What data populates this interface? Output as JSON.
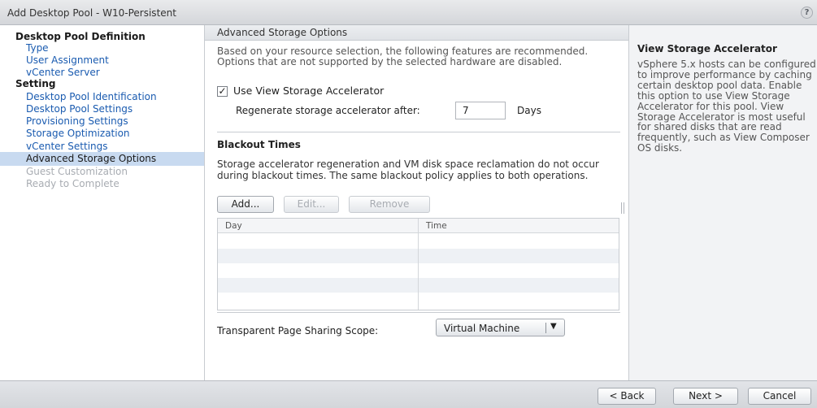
{
  "window": {
    "title": "Add Desktop Pool - W10-Persistent",
    "help_icon": "?"
  },
  "nav": {
    "section1_heading": "Desktop Pool Definition",
    "section1_items": [
      {
        "label": "Type",
        "state": "link"
      },
      {
        "label": "User Assignment",
        "state": "link"
      },
      {
        "label": "vCenter Server",
        "state": "link"
      }
    ],
    "section2_heading": "Setting",
    "section2_items": [
      {
        "label": "Desktop Pool Identification",
        "state": "link"
      },
      {
        "label": "Desktop Pool Settings",
        "state": "link"
      },
      {
        "label": "Provisioning Settings",
        "state": "link"
      },
      {
        "label": "Storage Optimization",
        "state": "link"
      },
      {
        "label": "vCenter Settings",
        "state": "link"
      },
      {
        "label": "Advanced Storage Options",
        "state": "selected"
      },
      {
        "label": "Guest Customization",
        "state": "disabled"
      },
      {
        "label": "Ready to Complete",
        "state": "disabled"
      }
    ]
  },
  "main": {
    "section_title": "Advanced Storage Options",
    "intro_text": "Based on your resource selection, the following features are recommended. Options that are not supported by the selected hardware are disabled.",
    "use_accelerator": {
      "label": "Use View Storage Accelerator",
      "checked": true,
      "check_glyph": "✓"
    },
    "regenerate": {
      "label": "Regenerate storage accelerator after:",
      "value": "7",
      "unit": "Days"
    },
    "blackout": {
      "title": "Blackout Times",
      "description": "Storage accelerator regeneration and VM disk space reclamation do not occur during blackout times. The same blackout policy applies to both operations.",
      "add_label": "Add...",
      "edit_label": "Edit...",
      "remove_label": "Remove",
      "columns": [
        "Day",
        "Time"
      ],
      "rows": []
    },
    "page_sharing": {
      "label": "Transparent Page Sharing Scope:",
      "value": "Virtual Machine",
      "arrow_glyph": "▼"
    }
  },
  "help": {
    "title": "View Storage Accelerator",
    "body": "vSphere 5.x hosts can be configured to improve performance by caching certain desktop pool data. Enable this option to use View Storage Accelerator for this pool. View Storage Accelerator is most useful for shared disks that are read frequently, such as View Composer OS disks."
  },
  "footer": {
    "back_label": "< Back",
    "next_label": "Next >",
    "cancel_label": "Cancel"
  },
  "colors": {
    "link": "#1a5bb0",
    "selected_bg": "#c8daf0",
    "disabled_text": "#a8acb2"
  }
}
